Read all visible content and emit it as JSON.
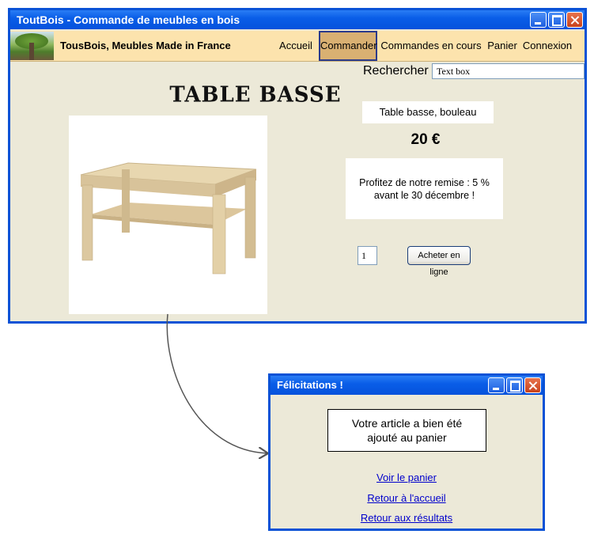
{
  "main_window": {
    "title": "ToutBois - Commande de meubles en bois",
    "brand": "TousBois, Meubles Made in France",
    "nav": [
      {
        "label": "Accueil",
        "active": false
      },
      {
        "label": "Commander",
        "active": true
      },
      {
        "label": "Commandes en cours",
        "active": false
      },
      {
        "label": "Panier",
        "active": false
      },
      {
        "label": "Connexion",
        "active": false
      }
    ],
    "search": {
      "label": "Rechercher",
      "value": "Text box"
    }
  },
  "product": {
    "title": "TABLE BASSE",
    "name": "Table basse, bouleau",
    "price": "20 €",
    "promo_line1": "Profitez de notre remise : 5 %",
    "promo_line2": "avant le 30 décembre !",
    "quantity": "1",
    "buy_label": "Acheter en ligne"
  },
  "popup": {
    "title": "Félicitations !",
    "message_line1": "Votre article a bien été",
    "message_line2": "ajouté au panier",
    "links": [
      "Voir le panier",
      "Retour à l'accueil",
      "Retour aux résultats"
    ]
  },
  "colors": {
    "window_frame": "#0a52d6",
    "nav_background": "#fce3ad",
    "nav_active": "#d9b072",
    "window_body": "#ece9d8",
    "link": "#0000cc"
  }
}
